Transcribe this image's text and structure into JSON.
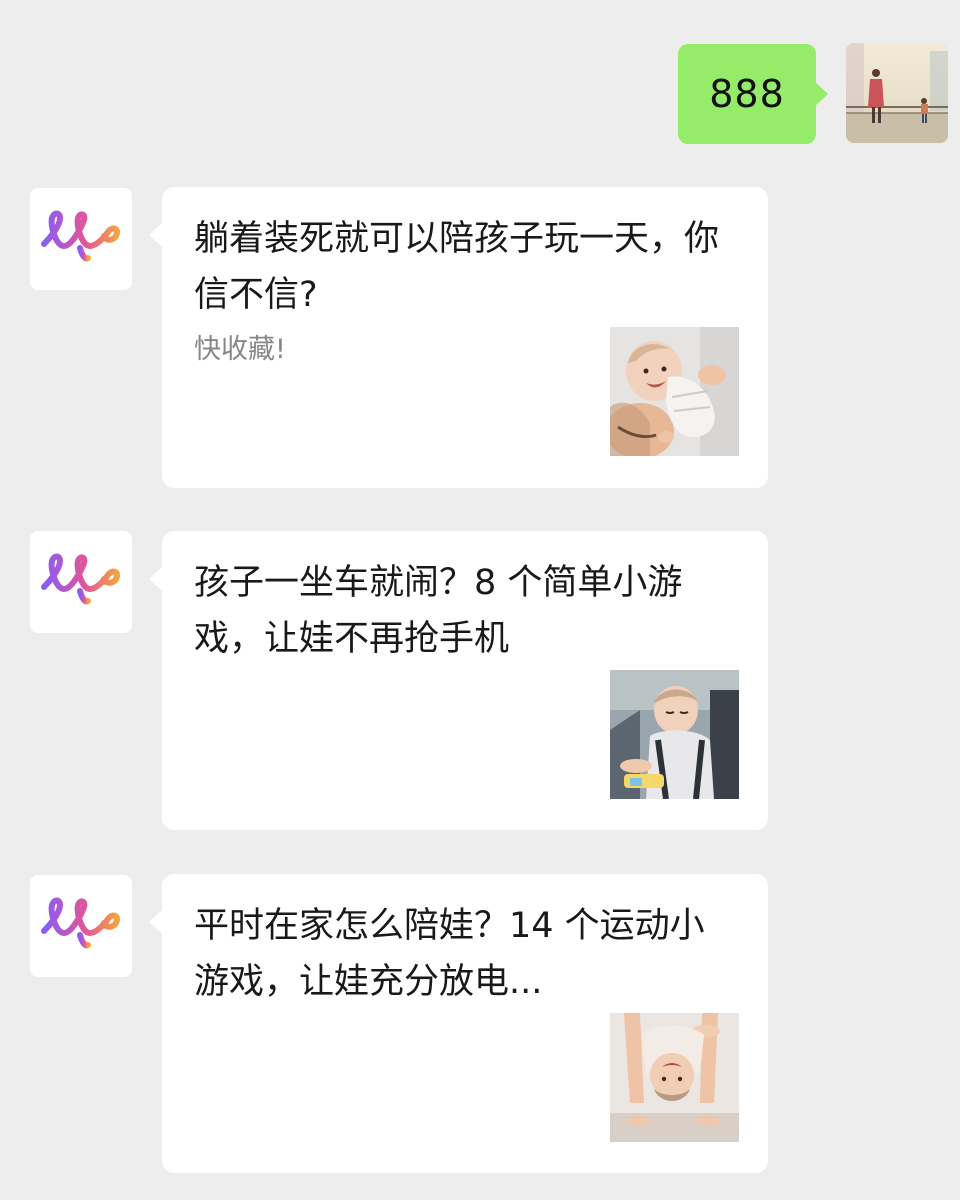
{
  "chat": {
    "outgoing": {
      "text": "888",
      "bubble_color": "#95ec69",
      "avatar_icon": "user-avatar-photo"
    },
    "account_avatar_icon": "loop-logo-icon",
    "account_logo_colors": [
      "#8a5cf6",
      "#e0559a",
      "#f4a340"
    ],
    "articles": [
      {
        "title": "躺着装死就可以陪孩子玩一天，你信不信?",
        "desc": "快收藏!",
        "thumb_icon": "parent-with-baby-thumbnail"
      },
      {
        "title": "孩子一坐车就闹？8 个简单小游戏，让娃不再抢手机",
        "desc": "",
        "thumb_icon": "baby-in-car-seat-thumbnail"
      },
      {
        "title": "平时在家怎么陪娃？14 个运动小游戏，让娃充分放电...",
        "desc": "",
        "thumb_icon": "upside-down-child-thumbnail"
      }
    ]
  }
}
